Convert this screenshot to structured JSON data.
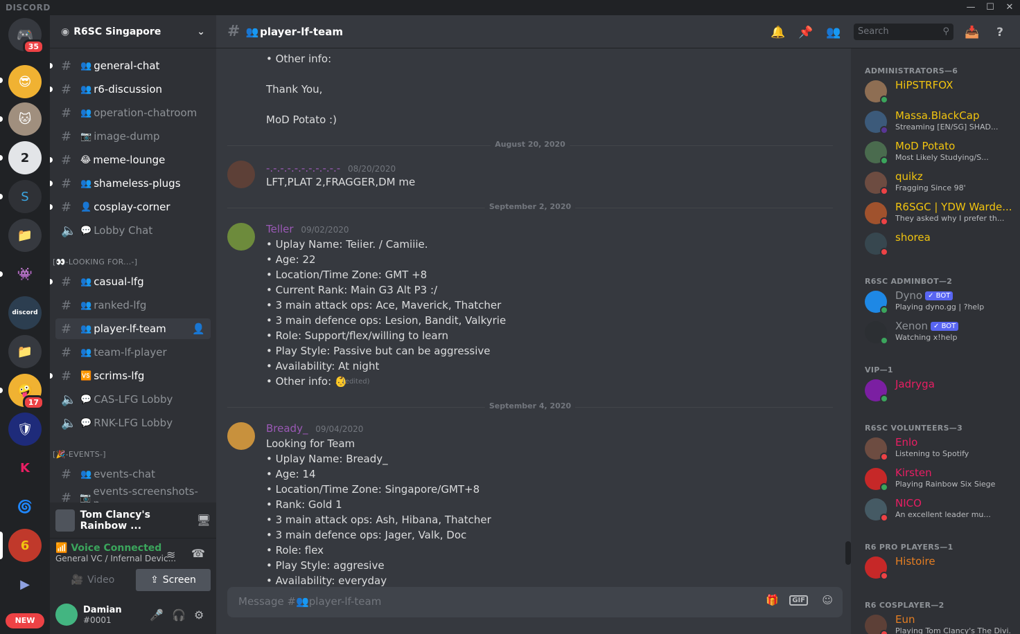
{
  "app": {
    "brand": "DISCORD"
  },
  "window": {
    "minimize": "—",
    "maximize": "☐",
    "close": "✕"
  },
  "guilds": {
    "home_badge": "35",
    "badge_17": "17",
    "new_label": "NEW",
    "discord_bio": "discord"
  },
  "server": {
    "name": "R6SC Singapore"
  },
  "channels": [
    {
      "name": "general-chat",
      "emoji": "👥"
    },
    {
      "name": "r6-discussion",
      "emoji": "👥"
    },
    {
      "name": "operation-chatroom",
      "emoji": "👥"
    },
    {
      "name": "image-dump",
      "emoji": "📷"
    },
    {
      "name": "meme-lounge",
      "emoji": "😂"
    },
    {
      "name": "shameless-plugs",
      "emoji": "👥"
    },
    {
      "name": "cosplay-corner",
      "emoji": "👤"
    },
    {
      "name": "Lobby Chat",
      "emoji": "💬"
    }
  ],
  "categories": {
    "looking_for": "[👀-LOOKING FOR...-]",
    "events": "[🎉-EVENTS-]"
  },
  "lfg_channels": [
    {
      "name": "casual-lfg",
      "emoji": "👥"
    },
    {
      "name": "ranked-lfg",
      "emoji": "👥"
    },
    {
      "name": "player-lf-team",
      "emoji": "👥"
    },
    {
      "name": "team-lf-player",
      "emoji": "👥"
    },
    {
      "name": "scrims-lfg",
      "emoji": "🆚"
    },
    {
      "name": "CAS-LFG Lobby",
      "emoji": "💬"
    },
    {
      "name": "RNK-LFG Lobby",
      "emoji": "💬"
    }
  ],
  "event_channels": [
    {
      "name": "events-chat",
      "emoji": "👥"
    },
    {
      "name": "events-screenshots-p...",
      "emoji": "📷"
    }
  ],
  "activity": {
    "game": "Tom Clancy's Rainbow ..."
  },
  "voice": {
    "status": "Voice Connected",
    "channel": "General VC / Infernal Devic..."
  },
  "voice_buttons": {
    "video": "Video",
    "screen": "Screen"
  },
  "user": {
    "name": "Damian",
    "tag": "#0001"
  },
  "channel_header": {
    "name": "player-lf-team",
    "search_placeholder": "Search"
  },
  "messages": {
    "m0_lines": [
      "• Other info:",
      "Thank You,",
      "MoD Potato :)"
    ],
    "d1": "August 20, 2020",
    "m1": {
      "author": "-.-.-.-.-.-.-.-.-.-.-",
      "time": "08/20/2020",
      "text": "LFT,PLAT 2,FRAGGER,DM me"
    },
    "d2": "September 2, 2020",
    "m2": {
      "author": "Teller",
      "time": "09/02/2020",
      "lines": [
        "• Uplay Name: Teiier. / Camiiie.",
        "• Age: 22",
        "• Location/Time Zone: GMT +8",
        "• Current Rank: Main G3 Alt P3 :/",
        "• 3 main attack ops: Ace, Maverick, Thatcher",
        "• 3 main defence ops: Lesion, Bandit, Valkyrie",
        "• Role: Support/flex/willing to learn",
        "• Play Style: Passive but can be aggressive",
        "• Availability: At night",
        "• Other info: 👶"
      ],
      "edited": "(edited)"
    },
    "d3": "September 4, 2020",
    "m3": {
      "author": "Bready_",
      "time": "09/04/2020",
      "lines": [
        "Looking for Team",
        "• Uplay Name: Bready_",
        "• Age: 14",
        "• Location/Time Zone: Singapore/GMT+8",
        "• Rank: Gold 1",
        "• 3 main attack ops: Ash, Hibana, Thatcher",
        "• 3 main defence ops: Jager, Valk, Doc",
        "• Role: flex",
        "• Play Style: aggresive",
        "• Availability: everyday"
      ]
    }
  },
  "composer": {
    "placeholder": "Message #👥player-lf-team",
    "gif": "GIF"
  },
  "members": {
    "admins": "ADMINISTRATORS—6",
    "admin_list": [
      {
        "name": "HiPSTRFOX",
        "sub": "",
        "color": "#f1c40f"
      },
      {
        "name": "Massa.BlackCap",
        "sub": "Streaming [EN/SG] SHAD...",
        "color": "#f1c40f"
      },
      {
        "name": "MoD Potato",
        "sub": "Most Likely Studying/S...",
        "color": "#f1c40f"
      },
      {
        "name": "quikz",
        "sub": "Fragging Since 98'",
        "color": "#f1c40f"
      },
      {
        "name": "R6SGC | YDW Warde...",
        "sub": "They asked why I prefer th...",
        "color": "#f1c40f"
      },
      {
        "name": "shorea",
        "sub": "",
        "color": "#f1c40f"
      }
    ],
    "adminbot": "R6SC ADMINBOT—2",
    "bots": [
      {
        "name": "Dyno",
        "sub": "Playing dyno.gg | ?help",
        "tag": "✓ BOT"
      },
      {
        "name": "Xenon",
        "sub": "Watching x!help",
        "tag": "✓ BOT"
      }
    ],
    "vip": "VIP—1",
    "vip_list": [
      {
        "name": "Jadryga"
      }
    ],
    "volunteers": "R6SC VOLUNTEERS—3",
    "volunteer_list": [
      {
        "name": "Enlo",
        "sub": "Listening to Spotify"
      },
      {
        "name": "Kirsten",
        "sub": "Playing Rainbow Six Siege"
      },
      {
        "name": "NICO",
        "sub": "An excellent leader mu..."
      }
    ],
    "pro": "R6 PRO PLAYERS—1",
    "pro_list": [
      {
        "name": "Histoire"
      }
    ],
    "cosplayers": "R6 COSPLAYER—2",
    "cosplay_list": [
      {
        "name": "Eun",
        "sub": "Playing Tom Clancy's The Divi..."
      }
    ]
  }
}
